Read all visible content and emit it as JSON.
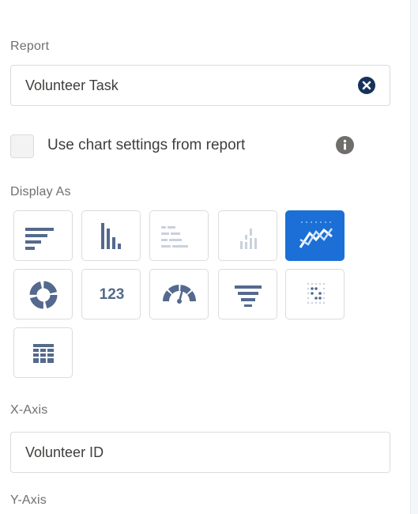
{
  "report": {
    "label": "Report",
    "value": "Volunteer Task",
    "clear_icon": "clear-circle-icon"
  },
  "chart_settings": {
    "label": "Use chart settings from report",
    "checked": false,
    "info_icon": "info-icon"
  },
  "display_as": {
    "label": "Display As",
    "selected": "line",
    "options": [
      {
        "icon": "horizontal-bar-icon"
      },
      {
        "icon": "vertical-bar-icon"
      },
      {
        "icon": "stacked-horizontal-bar-icon"
      },
      {
        "icon": "stacked-vertical-bar-icon"
      },
      {
        "icon": "line-chart-icon"
      },
      {
        "icon": "donut-chart-icon"
      },
      {
        "icon": "metric-icon",
        "text": "123"
      },
      {
        "icon": "gauge-icon"
      },
      {
        "icon": "funnel-icon"
      },
      {
        "icon": "scatter-icon"
      },
      {
        "icon": "table-icon"
      }
    ]
  },
  "x_axis": {
    "label": "X-Axis",
    "value": "Volunteer ID"
  },
  "y_axis": {
    "label": "Y-Axis"
  },
  "colors": {
    "accent": "#1b6fd6",
    "icon": "#54698d",
    "icon_muted": "#c9d1dc",
    "border": "#dddbda"
  }
}
